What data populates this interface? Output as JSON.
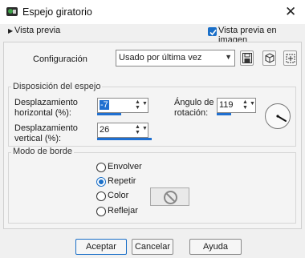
{
  "window": {
    "title": "Espejo giratorio",
    "close_glyph": "✕"
  },
  "topbar": {
    "preview_toggle": "Vista previa",
    "preview_checkbox_label": "Vista previa en imagen",
    "preview_checked": true
  },
  "config": {
    "label": "Configuración",
    "preset_value": "Usado por última vez"
  },
  "layout_group": {
    "title": "Disposición del espejo",
    "h_offset_label": "Desplazamiento horizontal (%):",
    "h_offset_value": "-7",
    "v_offset_label": "Desplazamiento vertical (%):",
    "v_offset_value": "26",
    "angle_label": "Ángulo de rotación:",
    "angle_value": "119"
  },
  "edge_group": {
    "title": "Modo de borde",
    "options": [
      "Envolver",
      "Repetir",
      "Color",
      "Reflejar"
    ],
    "selected": "Repetir"
  },
  "buttons": {
    "ok": "Aceptar",
    "cancel": "Cancelar",
    "help": "Ayuda"
  },
  "colors": {
    "accent": "#1a6fc8",
    "background": "#f0f0f0"
  }
}
